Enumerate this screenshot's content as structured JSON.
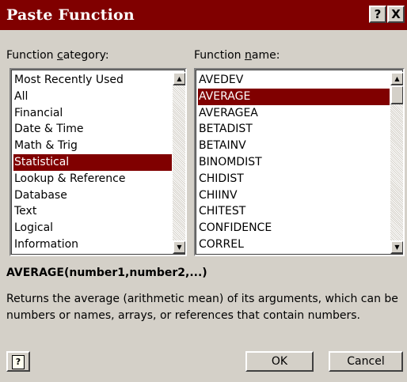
{
  "window": {
    "title": "Paste Function",
    "help_glyph": "?",
    "close_glyph": "X"
  },
  "category": {
    "label_pre": "Function ",
    "label_accel": "c",
    "label_post": "ategory:",
    "items": [
      "Most Recently Used",
      "All",
      "Financial",
      "Date & Time",
      "Math & Trig",
      "Statistical",
      "Lookup & Reference",
      "Database",
      "Text",
      "Logical",
      "Information"
    ],
    "selected": "Statistical"
  },
  "functions": {
    "label_pre": "Function ",
    "label_accel": "n",
    "label_post": "ame:",
    "items": [
      "AVEDEV",
      "AVERAGE",
      "AVERAGEA",
      "BETADIST",
      "BETAINV",
      "BINOMDIST",
      "CHIDIST",
      "CHIINV",
      "CHITEST",
      "CONFIDENCE",
      "CORREL"
    ],
    "selected": "AVERAGE"
  },
  "syntax": "AVERAGE(number1,number2,...)",
  "description": "Returns the average (arithmetic mean) of its arguments, which can be numbers or names, arrays, or references that contain numbers.",
  "buttons": {
    "ok": "OK",
    "cancel": "Cancel",
    "office_assistant_glyph": "?"
  },
  "scroll_arrows": {
    "up": "▲",
    "down": "▼"
  },
  "colors": {
    "titlebar": "#800000",
    "selection": "#800000",
    "face": "#d4d0c8"
  }
}
